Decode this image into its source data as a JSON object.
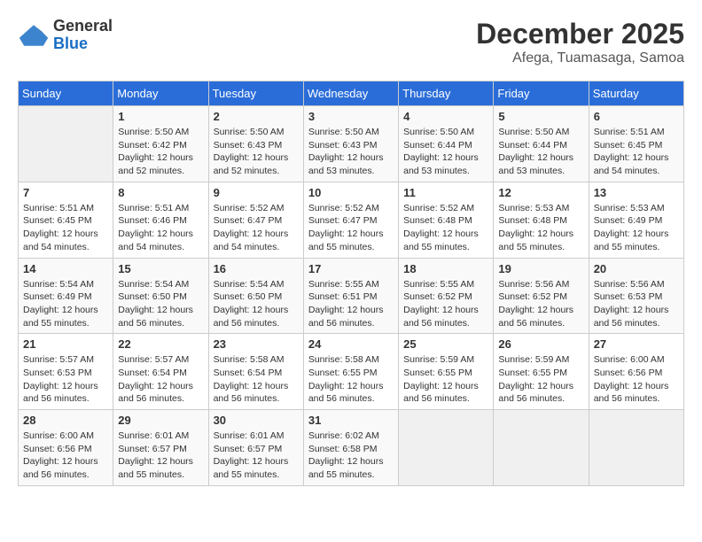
{
  "header": {
    "logo_general": "General",
    "logo_blue": "Blue",
    "month": "December 2025",
    "location": "Afega, Tuamasaga, Samoa"
  },
  "days_of_week": [
    "Sunday",
    "Monday",
    "Tuesday",
    "Wednesday",
    "Thursday",
    "Friday",
    "Saturday"
  ],
  "weeks": [
    [
      {
        "day": "",
        "sunrise": "",
        "sunset": "",
        "daylight": ""
      },
      {
        "day": "1",
        "sunrise": "Sunrise: 5:50 AM",
        "sunset": "Sunset: 6:42 PM",
        "daylight": "Daylight: 12 hours and 52 minutes."
      },
      {
        "day": "2",
        "sunrise": "Sunrise: 5:50 AM",
        "sunset": "Sunset: 6:43 PM",
        "daylight": "Daylight: 12 hours and 52 minutes."
      },
      {
        "day": "3",
        "sunrise": "Sunrise: 5:50 AM",
        "sunset": "Sunset: 6:43 PM",
        "daylight": "Daylight: 12 hours and 53 minutes."
      },
      {
        "day": "4",
        "sunrise": "Sunrise: 5:50 AM",
        "sunset": "Sunset: 6:44 PM",
        "daylight": "Daylight: 12 hours and 53 minutes."
      },
      {
        "day": "5",
        "sunrise": "Sunrise: 5:50 AM",
        "sunset": "Sunset: 6:44 PM",
        "daylight": "Daylight: 12 hours and 53 minutes."
      },
      {
        "day": "6",
        "sunrise": "Sunrise: 5:51 AM",
        "sunset": "Sunset: 6:45 PM",
        "daylight": "Daylight: 12 hours and 54 minutes."
      }
    ],
    [
      {
        "day": "7",
        "sunrise": "Sunrise: 5:51 AM",
        "sunset": "Sunset: 6:45 PM",
        "daylight": "Daylight: 12 hours and 54 minutes."
      },
      {
        "day": "8",
        "sunrise": "Sunrise: 5:51 AM",
        "sunset": "Sunset: 6:46 PM",
        "daylight": "Daylight: 12 hours and 54 minutes."
      },
      {
        "day": "9",
        "sunrise": "Sunrise: 5:52 AM",
        "sunset": "Sunset: 6:47 PM",
        "daylight": "Daylight: 12 hours and 54 minutes."
      },
      {
        "day": "10",
        "sunrise": "Sunrise: 5:52 AM",
        "sunset": "Sunset: 6:47 PM",
        "daylight": "Daylight: 12 hours and 55 minutes."
      },
      {
        "day": "11",
        "sunrise": "Sunrise: 5:52 AM",
        "sunset": "Sunset: 6:48 PM",
        "daylight": "Daylight: 12 hours and 55 minutes."
      },
      {
        "day": "12",
        "sunrise": "Sunrise: 5:53 AM",
        "sunset": "Sunset: 6:48 PM",
        "daylight": "Daylight: 12 hours and 55 minutes."
      },
      {
        "day": "13",
        "sunrise": "Sunrise: 5:53 AM",
        "sunset": "Sunset: 6:49 PM",
        "daylight": "Daylight: 12 hours and 55 minutes."
      }
    ],
    [
      {
        "day": "14",
        "sunrise": "Sunrise: 5:54 AM",
        "sunset": "Sunset: 6:49 PM",
        "daylight": "Daylight: 12 hours and 55 minutes."
      },
      {
        "day": "15",
        "sunrise": "Sunrise: 5:54 AM",
        "sunset": "Sunset: 6:50 PM",
        "daylight": "Daylight: 12 hours and 56 minutes."
      },
      {
        "day": "16",
        "sunrise": "Sunrise: 5:54 AM",
        "sunset": "Sunset: 6:50 PM",
        "daylight": "Daylight: 12 hours and 56 minutes."
      },
      {
        "day": "17",
        "sunrise": "Sunrise: 5:55 AM",
        "sunset": "Sunset: 6:51 PM",
        "daylight": "Daylight: 12 hours and 56 minutes."
      },
      {
        "day": "18",
        "sunrise": "Sunrise: 5:55 AM",
        "sunset": "Sunset: 6:52 PM",
        "daylight": "Daylight: 12 hours and 56 minutes."
      },
      {
        "day": "19",
        "sunrise": "Sunrise: 5:56 AM",
        "sunset": "Sunset: 6:52 PM",
        "daylight": "Daylight: 12 hours and 56 minutes."
      },
      {
        "day": "20",
        "sunrise": "Sunrise: 5:56 AM",
        "sunset": "Sunset: 6:53 PM",
        "daylight": "Daylight: 12 hours and 56 minutes."
      }
    ],
    [
      {
        "day": "21",
        "sunrise": "Sunrise: 5:57 AM",
        "sunset": "Sunset: 6:53 PM",
        "daylight": "Daylight: 12 hours and 56 minutes."
      },
      {
        "day": "22",
        "sunrise": "Sunrise: 5:57 AM",
        "sunset": "Sunset: 6:54 PM",
        "daylight": "Daylight: 12 hours and 56 minutes."
      },
      {
        "day": "23",
        "sunrise": "Sunrise: 5:58 AM",
        "sunset": "Sunset: 6:54 PM",
        "daylight": "Daylight: 12 hours and 56 minutes."
      },
      {
        "day": "24",
        "sunrise": "Sunrise: 5:58 AM",
        "sunset": "Sunset: 6:55 PM",
        "daylight": "Daylight: 12 hours and 56 minutes."
      },
      {
        "day": "25",
        "sunrise": "Sunrise: 5:59 AM",
        "sunset": "Sunset: 6:55 PM",
        "daylight": "Daylight: 12 hours and 56 minutes."
      },
      {
        "day": "26",
        "sunrise": "Sunrise: 5:59 AM",
        "sunset": "Sunset: 6:55 PM",
        "daylight": "Daylight: 12 hours and 56 minutes."
      },
      {
        "day": "27",
        "sunrise": "Sunrise: 6:00 AM",
        "sunset": "Sunset: 6:56 PM",
        "daylight": "Daylight: 12 hours and 56 minutes."
      }
    ],
    [
      {
        "day": "28",
        "sunrise": "Sunrise: 6:00 AM",
        "sunset": "Sunset: 6:56 PM",
        "daylight": "Daylight: 12 hours and 56 minutes."
      },
      {
        "day": "29",
        "sunrise": "Sunrise: 6:01 AM",
        "sunset": "Sunset: 6:57 PM",
        "daylight": "Daylight: 12 hours and 55 minutes."
      },
      {
        "day": "30",
        "sunrise": "Sunrise: 6:01 AM",
        "sunset": "Sunset: 6:57 PM",
        "daylight": "Daylight: 12 hours and 55 minutes."
      },
      {
        "day": "31",
        "sunrise": "Sunrise: 6:02 AM",
        "sunset": "Sunset: 6:58 PM",
        "daylight": "Daylight: 12 hours and 55 minutes."
      },
      {
        "day": "",
        "sunrise": "",
        "sunset": "",
        "daylight": ""
      },
      {
        "day": "",
        "sunrise": "",
        "sunset": "",
        "daylight": ""
      },
      {
        "day": "",
        "sunrise": "",
        "sunset": "",
        "daylight": ""
      }
    ]
  ]
}
